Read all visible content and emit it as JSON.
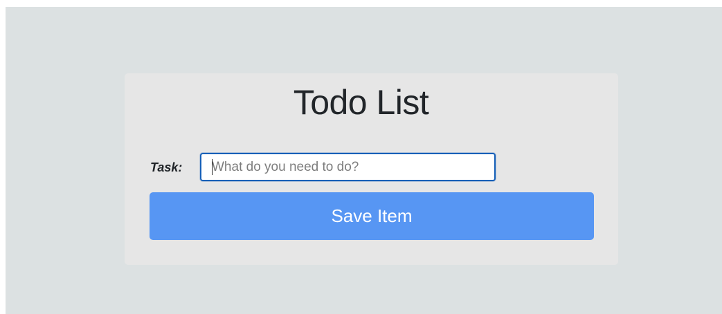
{
  "app": {
    "title": "Todo List"
  },
  "form": {
    "task_label": "Task:",
    "task_input_value": "",
    "task_input_placeholder": "What do you need to do?",
    "save_button_label": "Save Item"
  },
  "colors": {
    "page_background": "#dce1e2",
    "card_background": "#e6e6e6",
    "input_focus_border": "#1660b8",
    "button_background": "#5796f3",
    "button_text": "#ffffff",
    "title_text": "#212529"
  }
}
